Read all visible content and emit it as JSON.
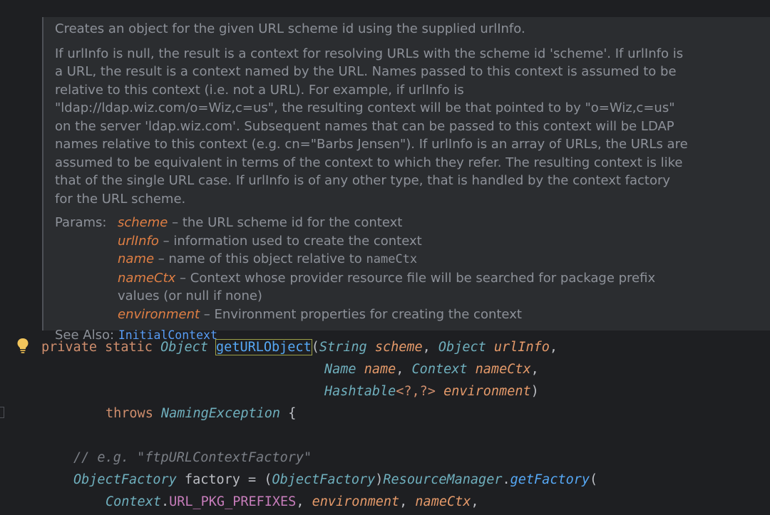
{
  "doc": {
    "summary": "Creates an object for the given URL scheme id using the supplied urlInfo.",
    "body": "If urlInfo is null, the result is a context for resolving URLs with the scheme id 'scheme'. If urlInfo is a URL, the result is a context named by the URL. Names passed to this context is assumed to be relative to this context (i.e. not a URL). For example, if urlInfo is \"ldap://ldap.wiz.com/o=Wiz,c=us\", the resulting context will be that pointed to by \"o=Wiz,c=us\" on the server 'ldap.wiz.com'. Subsequent names that can be passed to this context will be LDAP names relative to this context (e.g. cn=\"Barbs Jensen\"). If urlInfo is an array of URLs, the URLs are assumed to be equivalent in terms of the context to which they refer. The resulting context is like that of the single URL case. If urlInfo is of any other type, that is handled by the context factory for the URL scheme.",
    "params_label": "Params:",
    "params": [
      {
        "name": "scheme",
        "desc": " – the URL scheme id for the context",
        "code": ""
      },
      {
        "name": "urlInfo",
        "desc": " – information used to create the context",
        "code": ""
      },
      {
        "name": "name",
        "desc": " – name of this object relative to ",
        "code": "nameCtx"
      },
      {
        "name": "nameCtx",
        "desc": " – Context whose provider resource file will be searched for package prefix values (or null if none)",
        "code": ""
      },
      {
        "name": "environment",
        "desc": " – Environment properties for creating the context",
        "code": ""
      }
    ],
    "see_also_label": "See Also:",
    "see_also_link": "InitialContext"
  },
  "code": {
    "kw_private": "private",
    "kw_static": "static",
    "return_type": "Object",
    "method_name": "getURLObject",
    "type_string": "String",
    "p_scheme": "scheme",
    "type_object": "Object",
    "p_urlinfo": "urlInfo",
    "type_name": "Name",
    "p_name": "name",
    "type_context": "Context",
    "p_namectx": "nameCtx",
    "type_hashtable": "Hashtable",
    "generics": "<?,?>",
    "p_environment": "environment",
    "kw_throws": "throws",
    "type_exception": "NamingException",
    "comment": "// e.g. \"ftpURLContextFactory\"",
    "type_objectfactory": "ObjectFactory",
    "var_factory": "factory",
    "cast_type": "ObjectFactory",
    "class_resourcemanager": "ResourceManager",
    "method_getfactory": "getFactory",
    "class_context": "Context",
    "const_url_pkg": "URL_PKG_PREFIXES",
    "arg_environment": "environment",
    "arg_namectx": "nameCtx"
  },
  "colors": {
    "editor_background": "#1e1f22",
    "doc_background": "#2b2d30",
    "keyword": "#cf8e6d",
    "type": "#6fafbd",
    "parameter": "#e59a6a",
    "method": "#56a8f5",
    "comment": "#7a7e85",
    "constant": "#c77dbb",
    "link": "#589df6",
    "bulb": "#f2c55c"
  },
  "icons": {
    "intention": "lightbulb-icon"
  }
}
